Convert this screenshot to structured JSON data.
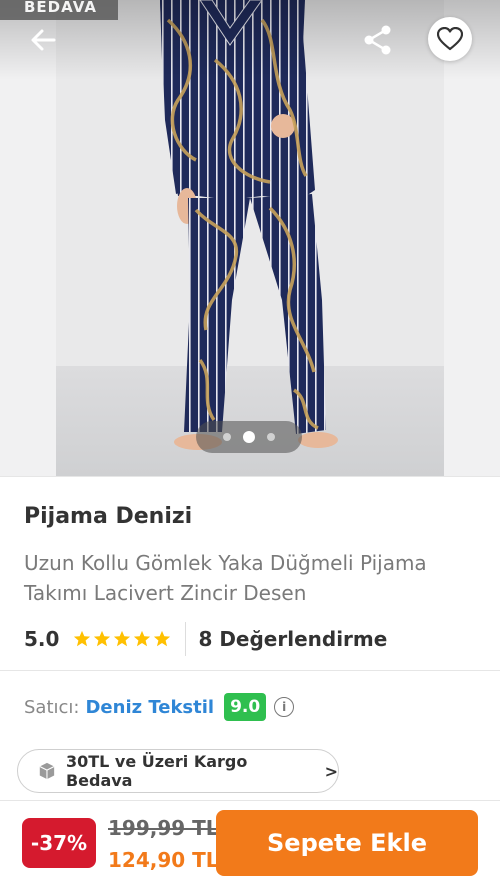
{
  "gallery": {
    "badge": "BEDAVA",
    "current_page": 2,
    "total_pages": 3
  },
  "product": {
    "brand": "Pijama Denizi",
    "title": "Uzun Kollu Gömlek Yaka Düğmeli Pijama Takımı Lacivert Zincir Desen",
    "rating": "5.0",
    "stars": 5,
    "review_count": "8 Değerlendirme"
  },
  "seller": {
    "label": "Satıcı:",
    "name": "Deniz Tekstil",
    "score": "9.0"
  },
  "shipping": {
    "text": "30TL ve Üzeri Kargo Bedava",
    "chevron": ">"
  },
  "pricing": {
    "discount": "-37%",
    "old_price": "199,99 TL",
    "new_price": "124,90 TL"
  },
  "cta": {
    "add_to_cart": "Sepete Ekle"
  },
  "colors": {
    "accent": "#f27a1a",
    "discount": "#d51a2e",
    "seller_link": "#2f86d6",
    "seller_score": "#2fbf4f",
    "star": "#ffc000",
    "pajama": "#1f2a5a"
  }
}
